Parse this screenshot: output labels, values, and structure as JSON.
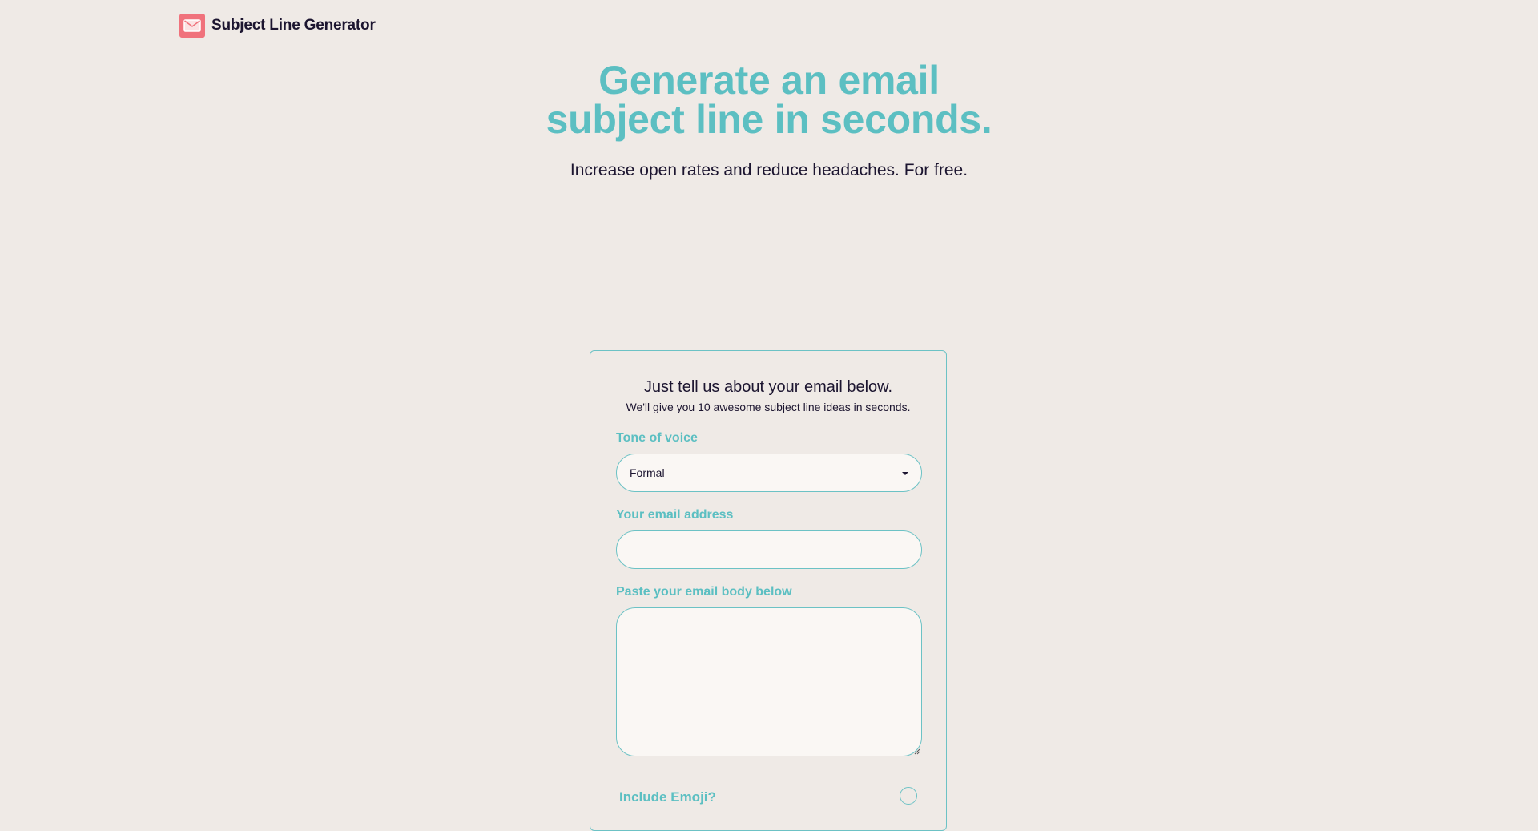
{
  "header": {
    "logo_icon": "envelope-icon",
    "brand": "Subject Line Generator"
  },
  "hero": {
    "title_line1": "Generate an email",
    "title_line2": "subject line in seconds.",
    "subtitle": "Increase open rates and reduce headaches. For free."
  },
  "form": {
    "title": "Just tell us about your email below.",
    "subtitle": "We'll give you 10 awesome subject line ideas in seconds.",
    "tone_label": "Tone of voice",
    "tone_value": "Formal",
    "email_label": "Your email address",
    "email_value": "",
    "body_label": "Paste your email body below",
    "body_value": "",
    "emoji_label": "Include Emoji?"
  },
  "colors": {
    "background": "#efeae6",
    "accent": "#5cbfc2",
    "text": "#1c1530",
    "logo": "#f0727c"
  }
}
